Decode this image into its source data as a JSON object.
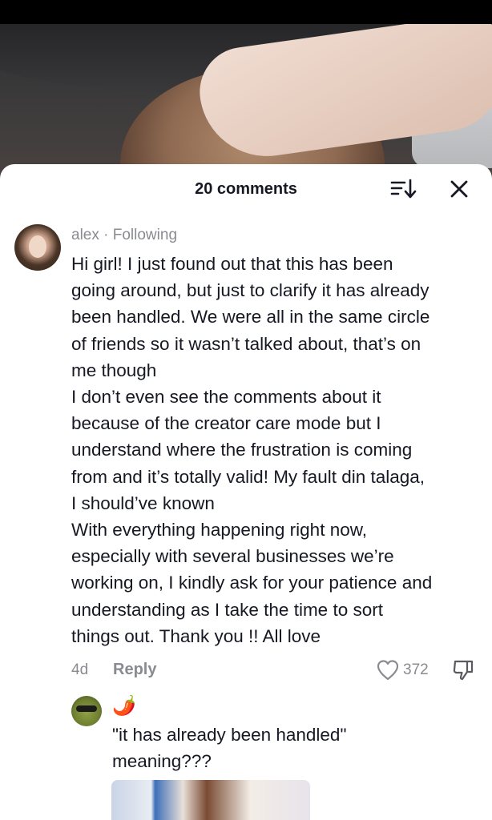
{
  "header": {
    "comments_count": "20 comments"
  },
  "comment": {
    "username": "alex",
    "separator": "·",
    "following_label": "Following",
    "text_lines": [
      "Hi girl! I just found out that this has been",
      "going around, but just to clarify it has already",
      "been handled. We were all in the same circle",
      "of friends so it wasn’t talked about, that’s on",
      "me though",
      "I don’t even see the comments about it",
      "because of the creator care mode but I",
      "understand where the frustration is coming",
      "from and it’s totally valid! My fault din talaga,",
      "I should’ve known",
      "With everything happening right now,",
      "especially with several businesses we’re",
      "working on, I kindly ask for your patience and",
      "understanding as I take the time to sort",
      "things out. Thank you !! All love"
    ],
    "time": "4d",
    "reply_label": "Reply",
    "like_count": "372"
  },
  "reply": {
    "username": "🌶️",
    "text_lines": [
      "\"it has already been handled\"",
      "meaning???"
    ]
  },
  "icons": {
    "sort": "sort-icon",
    "close": "close-icon",
    "like": "heart-icon",
    "dislike": "thumbs-down-icon"
  },
  "colors": {
    "text_primary": "#161823",
    "text_secondary": "#8a8b91",
    "sheet_bg": "#ffffff"
  }
}
